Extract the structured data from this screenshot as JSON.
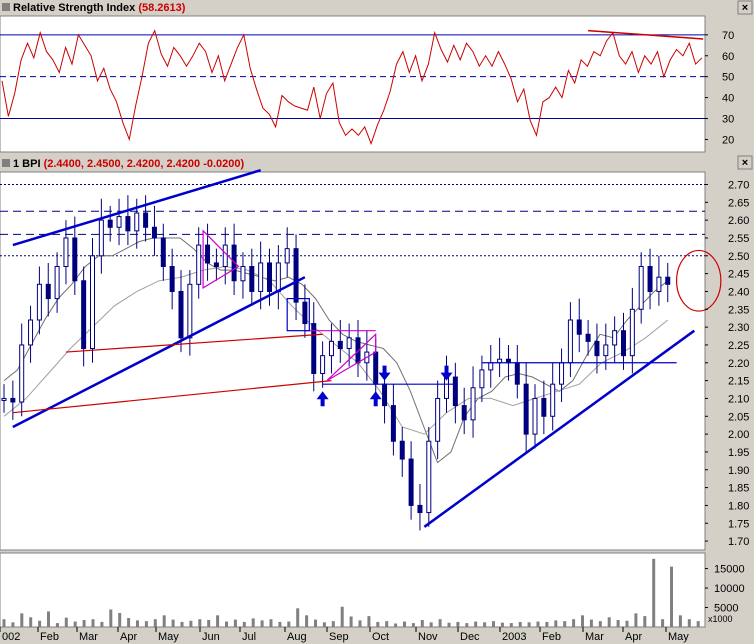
{
  "panels": {
    "rsi": {
      "title": "Relative Strength Index",
      "value": "(58.2613)",
      "close_glyph": "×"
    },
    "price": {
      "title": "1 BPI",
      "ohlc": "(2.4400, 2.4500, 2.4200, 2.4200 -0.0200)",
      "close_glyph": "×"
    },
    "volume": {
      "unit": "x1000"
    }
  },
  "colors": {
    "background": "#ffffff",
    "frame": "#d4d0c8",
    "rsi_line": "#cc0000",
    "candles": "#00007f",
    "trendline": "#0000cc",
    "horizontal_red": "#cc0000",
    "pattern_magenta": "#cc00cc"
  },
  "chart_data": [
    {
      "type": "line",
      "panel": "rsi",
      "title": "Relative Strength Index",
      "last_value": 58.2613,
      "yticks": [
        20,
        30,
        40,
        50,
        60,
        70
      ],
      "ylim": [
        14,
        79
      ],
      "reference_lines": [
        {
          "value": 70,
          "style": "solid"
        },
        {
          "value": 50,
          "style": "dashed"
        },
        {
          "value": 30,
          "style": "solid"
        }
      ],
      "series": [
        {
          "values": [
            48,
            31,
            42,
            58,
            66,
            59,
            71,
            62,
            58,
            52,
            64,
            56,
            70,
            65,
            60,
            48,
            54,
            44,
            38,
            28,
            20,
            36,
            50,
            66,
            72,
            61,
            55,
            64,
            60,
            55,
            60,
            66,
            62,
            52,
            60,
            48,
            56,
            64,
            70,
            54,
            44,
            35,
            32,
            26,
            41,
            38,
            36,
            35,
            34,
            45,
            30,
            42,
            47,
            28,
            22,
            25,
            22,
            26,
            18,
            27,
            34,
            43,
            56,
            62,
            52,
            60,
            48,
            56,
            71,
            63,
            57,
            65,
            58,
            66,
            62,
            55,
            60,
            55,
            62,
            56,
            49,
            38,
            44,
            29,
            22,
            38,
            40,
            45,
            40,
            53,
            47,
            58,
            55,
            62,
            60,
            67,
            71,
            60,
            56,
            62,
            52,
            60,
            56,
            62,
            50,
            58,
            63,
            60,
            66,
            56,
            59
          ]
        }
      ],
      "annotations": [
        {
          "type": "trendline",
          "from": [
            66,
            72
          ],
          "to": [
            79,
            68
          ],
          "color": "#cc0000"
        }
      ]
    },
    {
      "type": "candlestick",
      "panel": "price",
      "title": "1 BPI",
      "ohlc_label": "(2.4400, 2.4500, 2.4200, 2.4200 -0.0200)",
      "yticks": [
        1.7,
        1.75,
        1.8,
        1.85,
        1.9,
        1.95,
        2.0,
        2.05,
        2.1,
        2.15,
        2.2,
        2.25,
        2.3,
        2.35,
        2.4,
        2.45,
        2.5,
        2.55,
        2.6,
        2.65,
        2.7
      ],
      "ylim": [
        1.675,
        2.735
      ],
      "xlabels": [
        "002",
        "Feb",
        "Mar",
        "Apr",
        "May",
        "Jun",
        "Jul",
        "Aug",
        "Sep",
        "Oct",
        "Nov",
        "Dec",
        "2003",
        "Feb",
        "Mar",
        "Apr",
        "May"
      ],
      "close": [
        2.1,
        2.09,
        2.25,
        2.32,
        2.42,
        2.38,
        2.47,
        2.55,
        2.43,
        2.24,
        2.5,
        2.6,
        2.58,
        2.61,
        2.57,
        2.62,
        2.58,
        2.55,
        2.47,
        2.4,
        2.27,
        2.42,
        2.53,
        2.48,
        2.47,
        2.53,
        2.43,
        2.47,
        2.4,
        2.48,
        2.4,
        2.48,
        2.52,
        2.37,
        2.31,
        2.17,
        2.22,
        2.26,
        2.24,
        2.27,
        2.2,
        2.23,
        2.14,
        2.08,
        1.98,
        1.93,
        1.8,
        1.78,
        1.98,
        2.1,
        2.16,
        2.08,
        2.04,
        2.13,
        2.18,
        2.2,
        2.21,
        2.2,
        2.14,
        2.0,
        2.1,
        2.05,
        2.14,
        2.2,
        2.32,
        2.28,
        2.26,
        2.22,
        2.25,
        2.29,
        2.22,
        2.35,
        2.47,
        2.4,
        2.44,
        2.42
      ],
      "moving_averages": [
        {
          "color": "#707070",
          "values": [
            2.15,
            2.18,
            2.25,
            2.32,
            2.38,
            2.42,
            2.47,
            2.5,
            2.5,
            2.52,
            2.54,
            2.55,
            2.55,
            2.55,
            2.52,
            2.48,
            2.46,
            2.46,
            2.45,
            2.44,
            2.43,
            2.44,
            2.42,
            2.38,
            2.32,
            2.28,
            2.26,
            2.25,
            2.24,
            2.2,
            2.12,
            2.02,
            1.92,
            1.95,
            2.05,
            2.1,
            2.12,
            2.16,
            2.17,
            2.16,
            2.14,
            2.12,
            2.15,
            2.22,
            2.28,
            2.27,
            2.32,
            2.36,
            2.4,
            2.43
          ]
        },
        {
          "color": "#a0a0a0",
          "values": [
            2.05,
            2.1,
            2.17,
            2.24,
            2.3,
            2.36,
            2.4,
            2.43,
            2.44,
            2.46,
            2.47,
            2.46,
            2.43,
            2.36,
            2.3,
            2.25,
            2.2,
            2.12,
            2.02,
            2.0,
            2.06,
            2.1,
            2.1,
            2.08,
            2.1,
            2.12,
            2.14,
            2.2,
            2.23,
            2.27,
            2.32
          ]
        }
      ],
      "horizontal_lines": [
        {
          "value": 2.7,
          "style": "dotted"
        },
        {
          "value": 2.625,
          "style": "dashed"
        },
        {
          "value": 2.56,
          "style": "dashed"
        },
        {
          "value": 2.5,
          "style": "dotted"
        }
      ],
      "annotations": [
        {
          "type": "trendline",
          "color": "#0000cc",
          "from": [
            1.0,
            2.53
          ],
          "to": [
            29.0,
            2.74
          ]
        },
        {
          "type": "trendline",
          "color": "#0000cc",
          "from": [
            1.0,
            2.02
          ],
          "to": [
            34.0,
            2.44
          ]
        },
        {
          "type": "trendline",
          "color": "#0000cc",
          "from": [
            47.5,
            1.74
          ],
          "to": [
            78.0,
            2.29
          ]
        },
        {
          "type": "line",
          "color": "#cc0000",
          "from": [
            7.0,
            2.23
          ],
          "to": [
            36.0,
            2.28
          ]
        },
        {
          "type": "line",
          "color": "#cc0000",
          "from": [
            1.0,
            2.06
          ],
          "to": [
            37.0,
            2.15
          ]
        },
        {
          "type": "line",
          "color": "#0000cc",
          "from": [
            36.0,
            2.14
          ],
          "to": [
            51.0,
            2.14
          ]
        },
        {
          "type": "line",
          "color": "#0000cc",
          "from": [
            54.0,
            2.2
          ],
          "to": [
            76.0,
            2.2
          ]
        },
        {
          "type": "triangle",
          "color": "#cc00cc",
          "points": [
            [
              22.5,
              2.57
            ],
            [
              26.5,
              2.47
            ],
            [
              22.5,
              2.41
            ]
          ]
        },
        {
          "type": "triangle",
          "color": "#cc00cc",
          "points": [
            [
              36.5,
              2.15
            ],
            [
              42.0,
              2.28
            ],
            [
              42.0,
              2.23
            ]
          ]
        },
        {
          "type": "line",
          "color": "#cc00cc",
          "from": [
            34.0,
            2.29
          ],
          "to": [
            42.0,
            2.29
          ]
        },
        {
          "type": "box",
          "color": "#0000cc",
          "x": [
            32.0,
            34.5
          ],
          "y": [
            2.29,
            2.38
          ]
        },
        {
          "type": "ellipse",
          "color": "#cc0000",
          "center": [
            78.5,
            2.43
          ],
          "rx": 2.5,
          "ry": 0.085
        },
        {
          "type": "arrow_up",
          "color": "#0000cc",
          "at": [
            36.0,
            2.12
          ]
        },
        {
          "type": "arrow_up",
          "color": "#0000cc",
          "at": [
            42.0,
            2.12
          ]
        },
        {
          "type": "arrow_down",
          "color": "#0000cc",
          "at": [
            43.0,
            2.15
          ]
        },
        {
          "type": "arrow_down",
          "color": "#0000cc",
          "at": [
            50.0,
            2.15
          ]
        }
      ]
    },
    {
      "type": "bar",
      "panel": "volume",
      "unit": "x1000",
      "yticks": [
        5000,
        10000,
        15000
      ],
      "ylim": [
        0,
        19000
      ],
      "values": [
        2000,
        1200,
        3500,
        2500,
        1600,
        4000,
        1000,
        2400,
        1400,
        1800,
        2000,
        1300,
        4500,
        3600,
        2300,
        1700,
        1500,
        2000,
        3000,
        1900,
        1300,
        1600,
        2000,
        1800,
        3000,
        1400,
        1900,
        1300,
        2200,
        1700,
        2000,
        1300,
        1400,
        4800,
        3000,
        1900,
        1200,
        1500,
        5200,
        2700,
        1700,
        2800,
        1300,
        1500,
        900,
        1400,
        1000,
        1800,
        1200,
        2000,
        1100,
        1300,
        1000,
        1400,
        1200,
        1500,
        1100,
        1000,
        1300,
        1200,
        1400,
        1300,
        1700,
        1500,
        2000,
        3000,
        1900,
        1500,
        2500,
        1800,
        1600,
        3500,
        2800,
        17500,
        2000,
        15500,
        3000,
        2000,
        1500
      ]
    }
  ]
}
